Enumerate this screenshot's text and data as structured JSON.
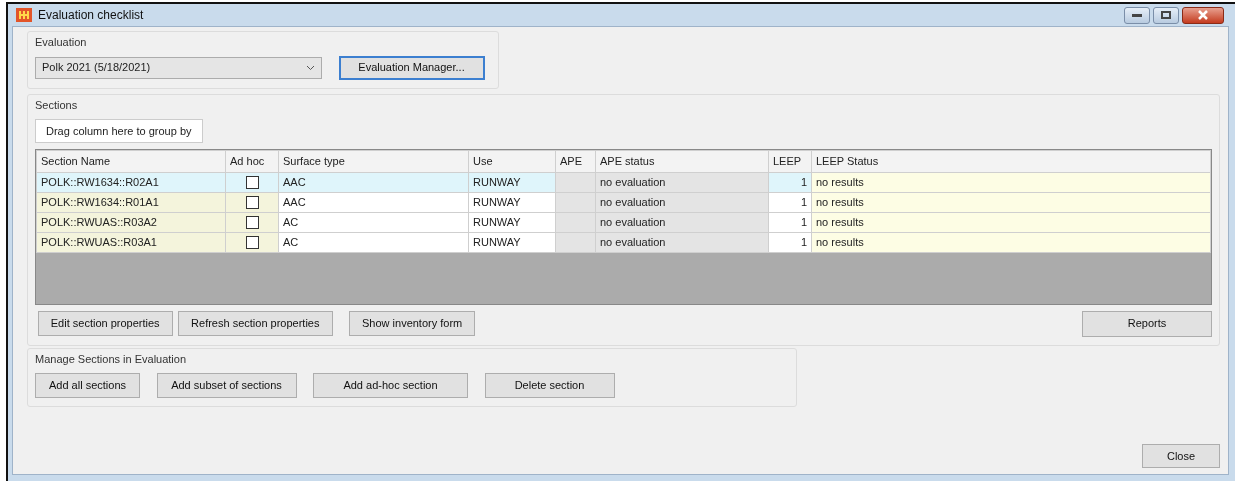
{
  "window": {
    "title": "Evaluation checklist"
  },
  "evaluation": {
    "label": "Evaluation",
    "selection": "Polk 2021 (5/18/2021)",
    "button": "Evaluation Manager..."
  },
  "sections": {
    "label": "Sections",
    "group_by_hint": "Drag column here to group by",
    "table": {
      "columns": [
        "Section Name",
        "Ad hoc",
        "Surface type",
        "Use",
        "APE",
        "APE status",
        "LEEP",
        "LEEP Status"
      ],
      "rows": [
        {
          "section_name": "POLK::RW1634::R02A1",
          "ad_hoc": false,
          "surface_type": "AAC",
          "use": "RUNWAY",
          "ape_status": "no evaluation",
          "leep": "1",
          "leep_status": "no results",
          "selected": true
        },
        {
          "section_name": "POLK::RW1634::R01A1",
          "ad_hoc": false,
          "surface_type": "AAC",
          "use": "RUNWAY",
          "ape_status": "no evaluation",
          "leep": "1",
          "leep_status": "no results",
          "selected": false
        },
        {
          "section_name": "POLK::RWUAS::R03A2",
          "ad_hoc": false,
          "surface_type": "AC",
          "use": "RUNWAY",
          "ape_status": "no evaluation",
          "leep": "1",
          "leep_status": "no results",
          "selected": false
        },
        {
          "section_name": "POLK::RWUAS::R03A1",
          "ad_hoc": false,
          "surface_type": "AC",
          "use": "RUNWAY",
          "ape_status": "no evaluation",
          "leep": "1",
          "leep_status": "no results",
          "selected": false
        }
      ]
    },
    "buttons": [
      "Edit section properties",
      "Refresh section properties",
      "Show inventory form"
    ],
    "reports_button": "Reports"
  },
  "manage": {
    "label": "Manage Sections in Evaluation",
    "buttons": [
      "Add all sections",
      "Add subset of sections",
      "Add ad-hoc section",
      "Delete section"
    ]
  },
  "close_button": "Close"
}
